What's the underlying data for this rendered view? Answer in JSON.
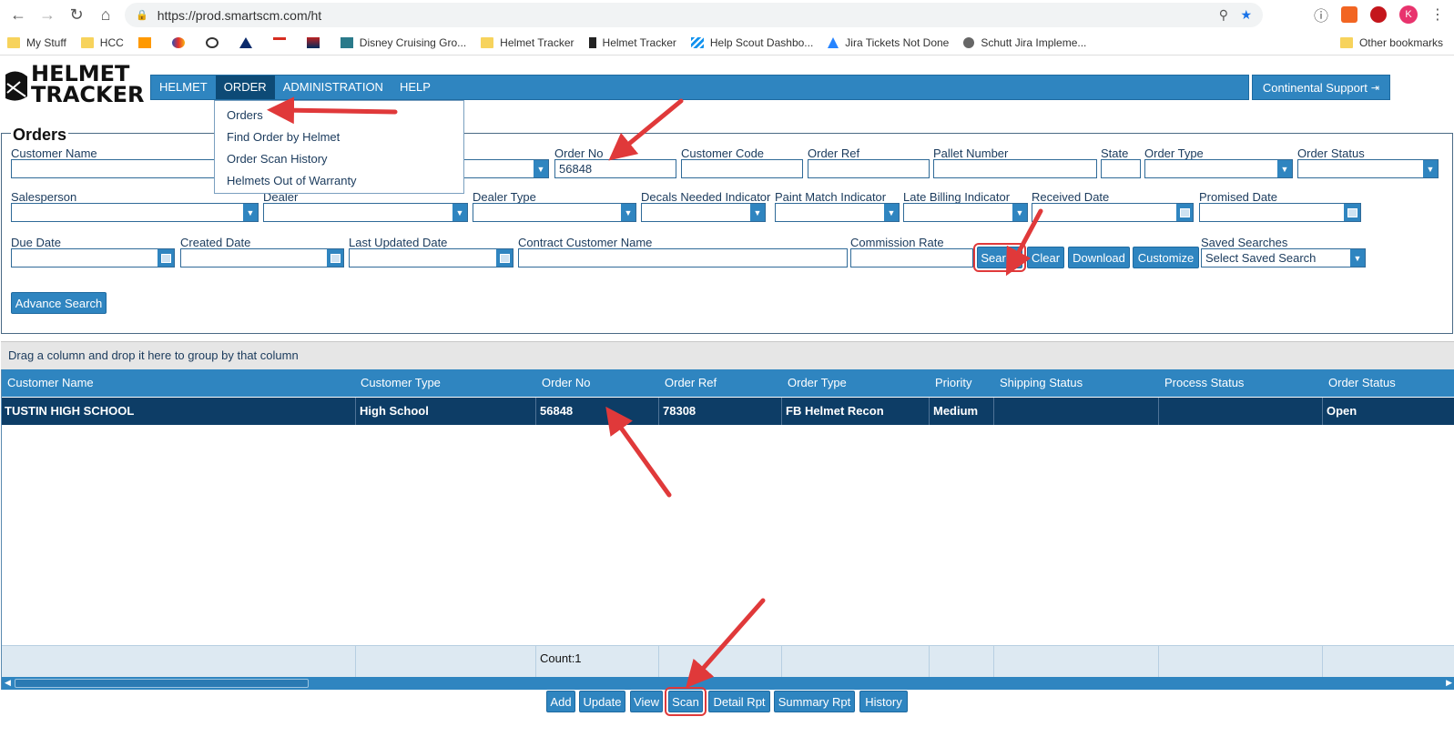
{
  "browser": {
    "url": "https://prod.smartscm.com/ht",
    "bookmarks": [
      {
        "label": "My Stuff",
        "icon": "folder-icon"
      },
      {
        "label": "HCC",
        "icon": "folder-icon"
      },
      {
        "label": "",
        "icon": "amazon-icon"
      },
      {
        "label": "",
        "icon": "southwest-icon"
      },
      {
        "label": "",
        "icon": "shield-icon"
      },
      {
        "label": "",
        "icon": "delta-icon"
      },
      {
        "label": "",
        "icon": "citi-icon"
      },
      {
        "label": "",
        "icon": "flag-icon"
      },
      {
        "label": "Disney Cruising Gro...",
        "icon": "dcl-icon"
      },
      {
        "label": "Helmet Tracker",
        "icon": "folder-icon"
      },
      {
        "label": "Helmet Tracker",
        "icon": "ht-icon"
      },
      {
        "label": "Help Scout Dashbo...",
        "icon": "helpscout-icon"
      },
      {
        "label": "Jira Tickets Not Done",
        "icon": "atlassian-icon"
      },
      {
        "label": "Schutt Jira Impleme...",
        "icon": "globe-icon"
      }
    ],
    "other_bookmarks": "Other bookmarks",
    "avatar_letter": "K"
  },
  "app": {
    "logo_line1": "HELMET",
    "logo_line2": "TRACKER",
    "menu": [
      "HELMET",
      "ORDER",
      "ADMINISTRATION",
      "HELP"
    ],
    "support_label": "Continental Support",
    "order_menu": [
      "Orders",
      "Find Order by Helmet",
      "Order Scan History",
      "Helmets Out of Warranty"
    ]
  },
  "orders": {
    "title": "Orders",
    "labels": {
      "customer_name": "Customer Name",
      "order_no": "Order No",
      "customer_code": "Customer Code",
      "order_ref": "Order Ref",
      "pallet_number": "Pallet Number",
      "state": "State",
      "order_type": "Order Type",
      "order_status": "Order Status",
      "salesperson": "Salesperson",
      "dealer": "Dealer",
      "dealer_type": "Dealer Type",
      "decals": "Decals Needed Indicator",
      "paint_match": "Paint Match Indicator",
      "late_billing": "Late Billing Indicator",
      "received_date": "Received Date",
      "promised_date": "Promised Date",
      "due_date": "Due Date",
      "created_date": "Created Date",
      "last_updated": "Last Updated Date",
      "contract_customer": "Contract Customer Name",
      "commission_rate": "Commission Rate",
      "saved_searches": "Saved Searches"
    },
    "values": {
      "order_no": "56848",
      "saved_search_placeholder": "Select Saved Search"
    },
    "buttons": {
      "search": "Search",
      "clear": "Clear",
      "download": "Download",
      "customize": "Customize",
      "advance_search": "Advance Search"
    }
  },
  "grid": {
    "group_hint": "Drag a column and drop it here to group by that column",
    "columns": [
      "Customer Name",
      "Customer Type",
      "Order No",
      "Order Ref",
      "Order Type",
      "Priority",
      "Shipping Status",
      "Process Status",
      "Order Status"
    ],
    "rows": [
      [
        "TUSTIN HIGH SCHOOL",
        "High School",
        "56848",
        "78308",
        "FB Helmet Recon",
        "Medium",
        "",
        "",
        "Open"
      ]
    ],
    "count": "Count:1"
  },
  "actions": [
    "Add",
    "Update",
    "View",
    "Scan",
    "Detail Rpt",
    "Summary Rpt",
    "History"
  ],
  "colors": {
    "primary": "#2f85c0",
    "selected_row": "#0d3d66",
    "annotation": "#e0393a"
  }
}
